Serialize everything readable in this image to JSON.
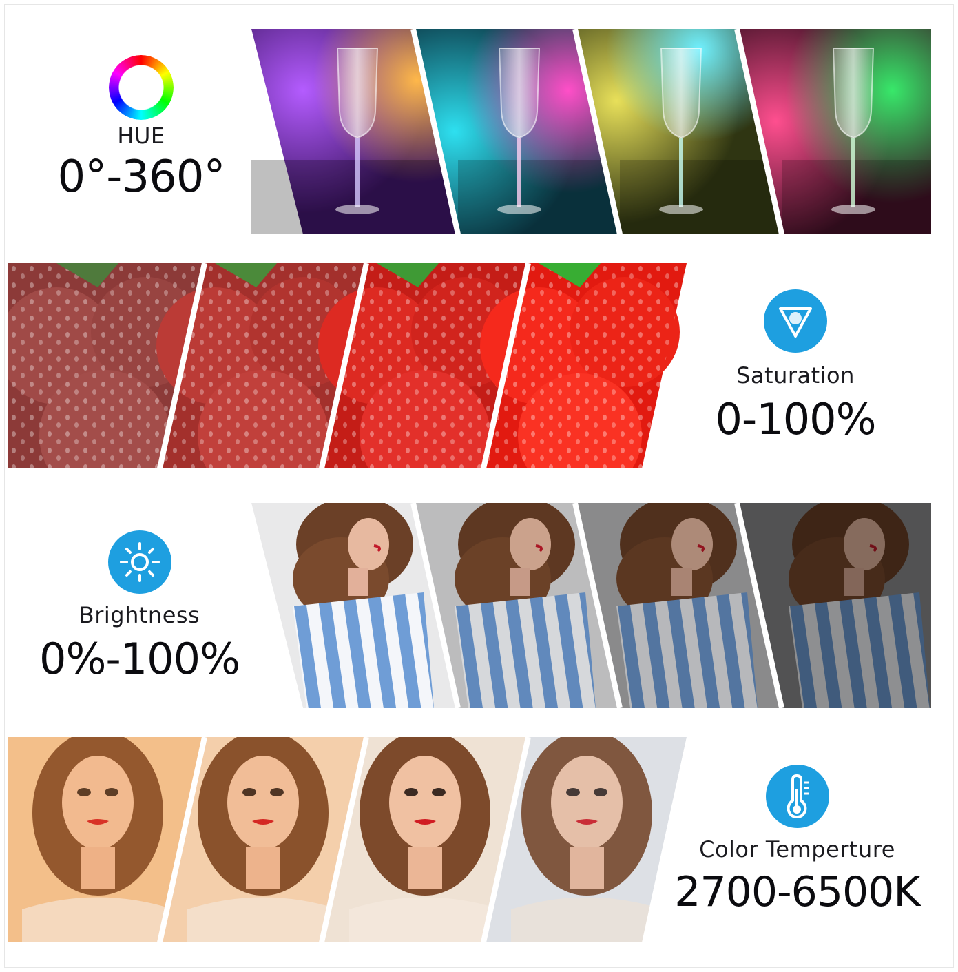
{
  "hue": {
    "caption": "HUE",
    "range": "0°-360°",
    "icon": "hue-ring-icon",
    "panels": [
      {
        "name": "wine-glass-violet-orange"
      },
      {
        "name": "wine-glass-cyan-magenta"
      },
      {
        "name": "wine-glass-yellow-teal"
      },
      {
        "name": "wine-glass-pink-green"
      }
    ]
  },
  "saturation": {
    "caption": "Saturation",
    "range": "0-100%",
    "icon": "saturation-drop-icon",
    "panels": [
      {
        "name": "strawberries-low-saturation"
      },
      {
        "name": "strawberries-mid-saturation"
      },
      {
        "name": "strawberries-high-saturation"
      },
      {
        "name": "strawberries-full-saturation"
      }
    ]
  },
  "brightness": {
    "caption": "Brightness",
    "range": "0%-100%",
    "icon": "sun-icon",
    "panels": [
      {
        "name": "woman-brightness-full"
      },
      {
        "name": "woman-brightness-high"
      },
      {
        "name": "woman-brightness-mid"
      },
      {
        "name": "woman-brightness-low"
      }
    ]
  },
  "color_temperature": {
    "caption": "Color Temperture",
    "range": "2700-6500K",
    "icon": "thermometer-icon",
    "panels": [
      {
        "name": "portrait-warm"
      },
      {
        "name": "portrait-warm-neutral"
      },
      {
        "name": "portrait-neutral"
      },
      {
        "name": "portrait-cool"
      }
    ]
  },
  "colors": {
    "icon_blue": "#1e9fe0",
    "text_dark": "#0b0b0f"
  }
}
